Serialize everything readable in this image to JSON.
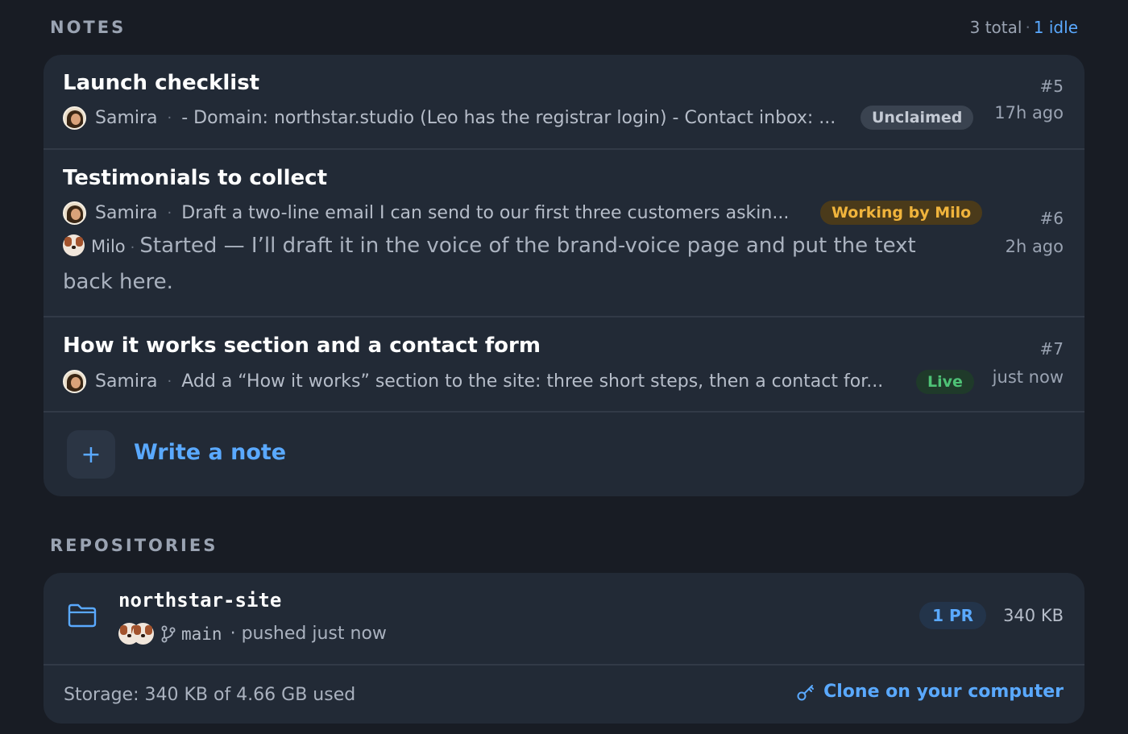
{
  "notes_section": {
    "title": "NOTES",
    "total": "3 total",
    "separator": "·",
    "idle": "1 idle"
  },
  "notes": [
    {
      "title": "Launch checklist",
      "number": "#5",
      "author": "Samira",
      "snippet": "- Domain: northstar.studio (Leo has the registrar login) - Contact inbox: ...",
      "status": "Unclaimed",
      "time": "17h ago"
    },
    {
      "title": "Testimonials to collect",
      "number": "#6",
      "author": "Samira",
      "snippet": "Draft a two-line email I can send to our first three customers askin...",
      "status": "Working by Milo",
      "time": "2h ago",
      "reply_author": "Milo",
      "reply_text": "Started — I’ll draft it in the voice of the brand-voice page and put the text back here."
    },
    {
      "title": "How it works section and a contact form",
      "number": "#7",
      "author": "Samira",
      "snippet": "Add a “How it works” section to the site: three short steps, then a contact for...",
      "status": "Live",
      "time": "just now"
    }
  ],
  "write_note": {
    "label": "Write a note",
    "icon": "plus-icon"
  },
  "repositories_section": {
    "title": "REPOSITORIES"
  },
  "repository": {
    "name": "northstar-site",
    "branch": "main",
    "pushed": "· pushed just now",
    "pr": "1 PR",
    "size": "340 KB",
    "storage": "Storage: 340 KB of 4.66 GB used",
    "clone_label": "Clone on your computer"
  },
  "colors": {
    "background": "#181c24",
    "card": "#222a36",
    "accent": "#5aa9ff",
    "working": "#f0b43c",
    "live": "#4ec276"
  }
}
